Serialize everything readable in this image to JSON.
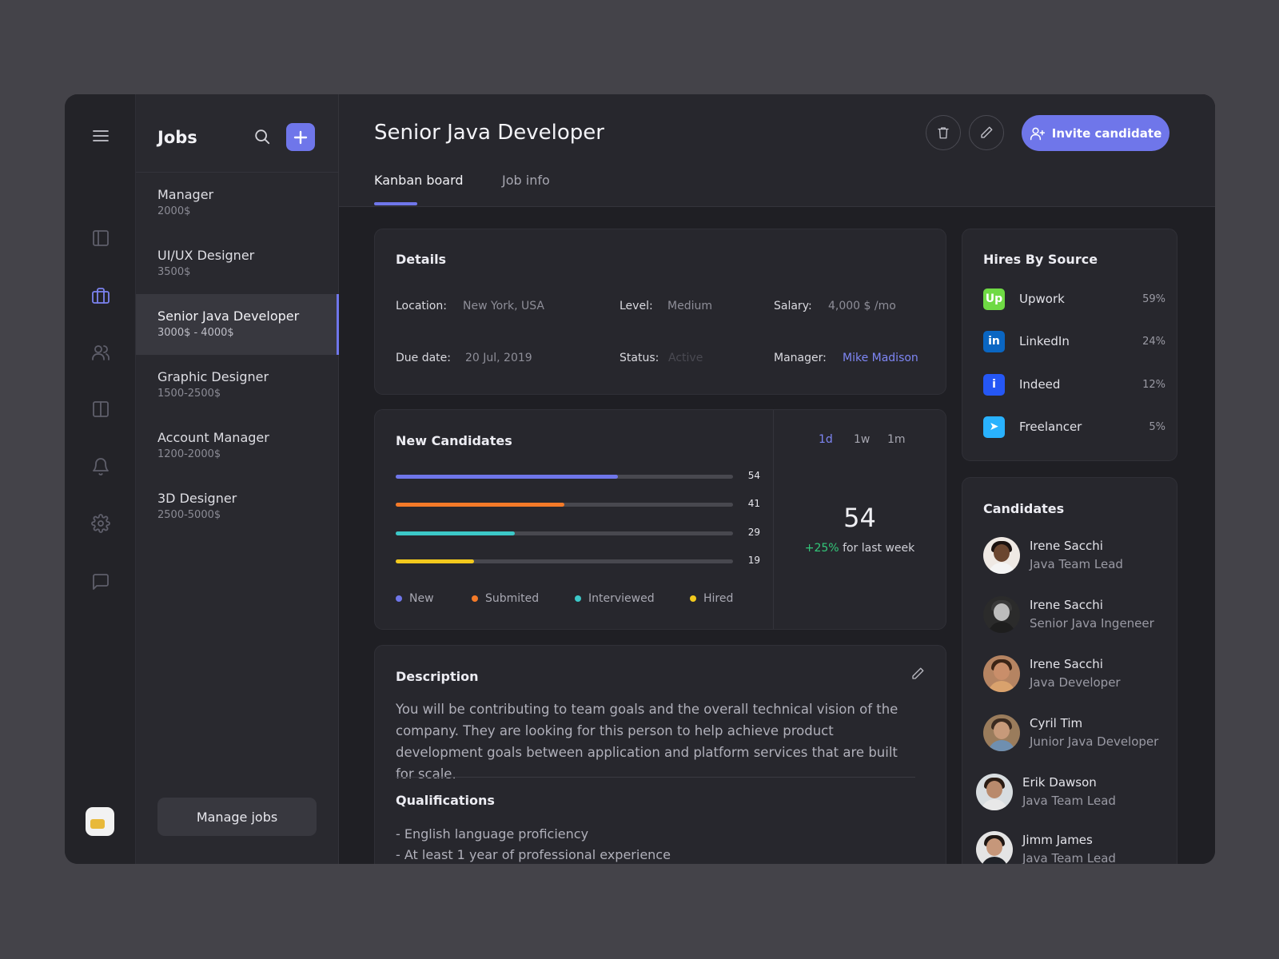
{
  "jobs": {
    "title": "Jobs",
    "items": [
      {
        "name": "Manager",
        "salary": "2000$"
      },
      {
        "name": "UI/UX Designer",
        "salary": "3500$"
      },
      {
        "name": "Senior Java Developer",
        "salary": "3000$ - 4000$"
      },
      {
        "name": "Graphic Designer",
        "salary": "1500-2500$"
      },
      {
        "name": "Account Manager",
        "salary": "1200-2000$"
      },
      {
        "name": "3D Designer",
        "salary": "2500-5000$"
      }
    ],
    "selected_index": 2,
    "manage_label": "Manage jobs"
  },
  "rail": {
    "icons": [
      "menu-icon",
      "panel-icon",
      "briefcase-icon",
      "users-icon",
      "columns-icon",
      "bell-icon",
      "gear-icon",
      "chat-icon"
    ],
    "active": "briefcase-icon"
  },
  "header": {
    "title": "Senior Java Developer",
    "invite_label": "Invite candidate",
    "tabs": [
      {
        "label": "Kanban board",
        "active": true
      },
      {
        "label": "Job info",
        "active": false
      }
    ]
  },
  "details": {
    "title": "Details",
    "location_label": "Location:",
    "location": "New York, USA",
    "level_label": "Level:",
    "level": "Medium",
    "salary_label": "Salary:",
    "salary": "4,000 $ /mo",
    "due_label": "Due date:",
    "due": "20 Jul, 2019",
    "status_label": "Status:",
    "status": "Active",
    "manager_label": "Manager:",
    "manager": "Mike Madison"
  },
  "new_candidates": {
    "title": "New Candidates",
    "periods": [
      "1d",
      "1w",
      "1m"
    ],
    "active_period": "1d",
    "total": "54",
    "growth_pct": "+25%",
    "growth_text": "for last week",
    "max": 100
  },
  "chart_data": {
    "type": "bar",
    "orientation": "horizontal",
    "categories": [
      "New",
      "Submited",
      "Interviewed",
      "Hired"
    ],
    "values": [
      54,
      41,
      29,
      19
    ],
    "xlim": [
      0,
      82
    ],
    "colors": [
      "#6f76ea",
      "#f47a28",
      "#3cc8c8",
      "#f2c91d"
    ],
    "legend_position": "bottom"
  },
  "description": {
    "title": "Description",
    "text": "You will be contributing to team goals and the overall technical vision of the company. They are looking for this person to help achieve product development goals between application and platform services that are built for scale.",
    "qualifications_title": "Qualifications",
    "qualifications": [
      "- English language proficiency",
      "- At least 1 year of professional experience"
    ]
  },
  "hires_by_source": {
    "title": "Hires By Source",
    "sources": [
      {
        "name": "Upwork",
        "pct": "59%",
        "logo": "Up",
        "color": "#6fda44"
      },
      {
        "name": "LinkedIn",
        "pct": "24%",
        "logo": "in",
        "color": "#0a66c2"
      },
      {
        "name": "Indeed",
        "pct": "12%",
        "logo": "i",
        "color": "#2557f5"
      },
      {
        "name": "Freelancer",
        "pct": "5%",
        "logo": "➤",
        "color": "#29b2fe"
      }
    ]
  },
  "candidates": {
    "title": "Candidates",
    "items": [
      {
        "name": "Irene Sacchi",
        "role": "Java Team Lead",
        "skin": "#6b4630",
        "hair": "#1b1210",
        "shirt": "#f4f4f4",
        "bg": "#efe9e4"
      },
      {
        "name": "Irene Sacchi",
        "role": "Senior Java Ingeneer",
        "skin": "#bdbdbd",
        "hair": "#3a3a3a",
        "shirt": "#1e1e1e",
        "bg": "#2b2b2b"
      },
      {
        "name": "Irene Sacchi",
        "role": "Java Developer",
        "skin": "#c98e6a",
        "hair": "#3b2416",
        "shirt": "#d9a26d",
        "bg": "#b58462"
      },
      {
        "name": "Cyril Tim",
        "role": "Junior Java Developer",
        "skin": "#c79a7a",
        "hair": "#3a2a20",
        "shirt": "#6f8fb0",
        "bg": "#9a7c5c"
      },
      {
        "name": "Erik Dawson",
        "role": "Java Team Lead",
        "skin": "#b98a6c",
        "hair": "#2a1c14",
        "shirt": "#e8e8e8",
        "bg": "#d8dde0"
      },
      {
        "name": "Jimm  James",
        "role": "Java Team Lead",
        "skin": "#c6977a",
        "hair": "#1e1612",
        "shirt": "#1f2228",
        "bg": "#e4e4e4"
      }
    ]
  }
}
